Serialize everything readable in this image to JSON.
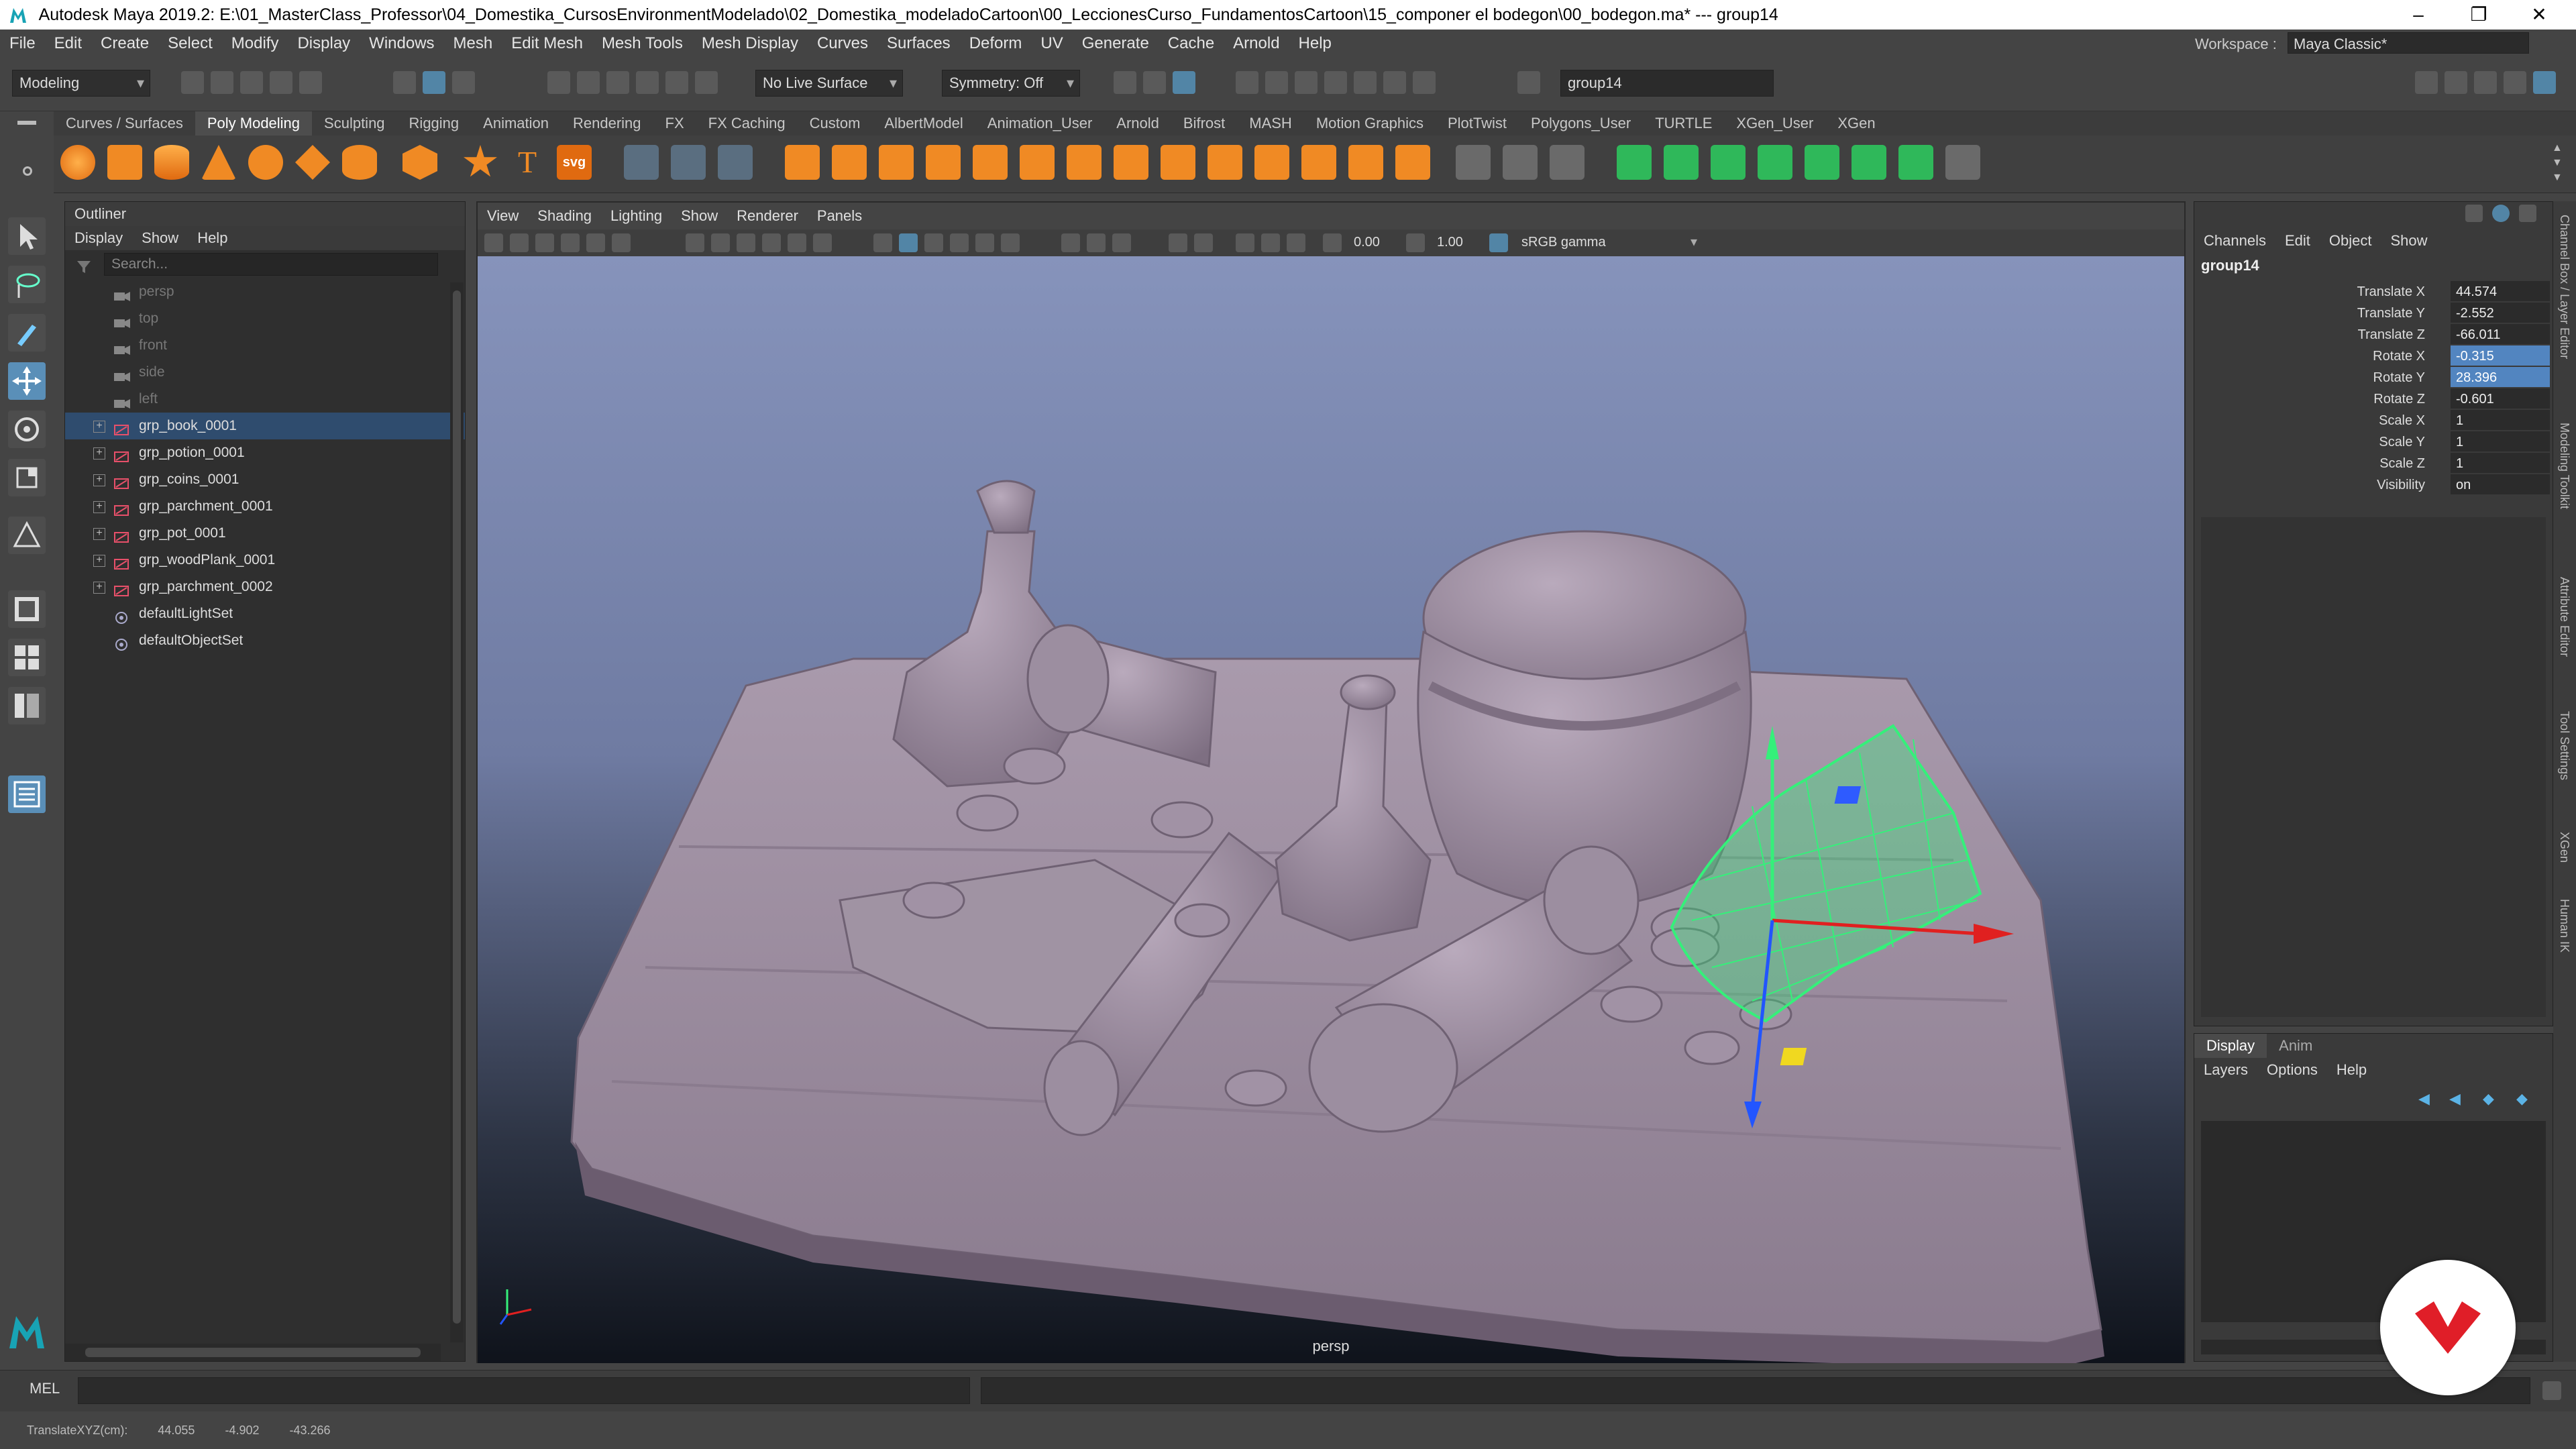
{
  "window": {
    "title": "Autodesk Maya 2019.2: E:\\01_MasterClass_Professor\\04_Domestika_CursosEnvironmentModelado\\02_Domestika_modeladoCartoon\\00_LeccionesCurso_FundamentosCartoon\\15_componer el bodegon\\00_bodegon.ma*   ---   group14",
    "controls": [
      "–",
      "❐",
      "✕"
    ]
  },
  "menubar": [
    "File",
    "Edit",
    "Create",
    "Select",
    "Modify",
    "Display",
    "Windows",
    "Mesh",
    "Edit Mesh",
    "Mesh Tools",
    "Mesh Display",
    "Curves",
    "Surfaces",
    "Deform",
    "UV",
    "Generate",
    "Cache",
    "Arnold",
    "Help"
  ],
  "workspace": {
    "label": "Workspace :",
    "value": "Maya Classic*"
  },
  "statusline": {
    "menuset": "Modeling",
    "live_surface": "No Live Surface",
    "symmetry": "Symmetry: Off",
    "selection_field": "group14"
  },
  "shelf_tabs": [
    "Curves / Surfaces",
    "Poly Modeling",
    "Sculpting",
    "Rigging",
    "Animation",
    "Rendering",
    "FX",
    "FX Caching",
    "Custom",
    "AlbertModel",
    "Animation_User",
    "Arnold",
    "Bifrost",
    "MASH",
    "Motion Graphics",
    "PlotTwist",
    "Polygons_User",
    "TURTLE",
    "XGen_User",
    "XGen"
  ],
  "shelf_active": "Poly Modeling",
  "shelf_labels": {
    "text_tool": "T",
    "svg_tool": "svg"
  },
  "colors": {
    "accent": "#5285c0",
    "shelf_orange": "#f08a24",
    "shelf_green": "#2fb85a",
    "manip_green": "#35f07a"
  },
  "outliner": {
    "title": "Outliner",
    "menu": [
      "Display",
      "Show",
      "Help"
    ],
    "search_placeholder": "Search...",
    "items": [
      {
        "label": "persp",
        "kind": "camera",
        "dim": true
      },
      {
        "label": "top",
        "kind": "camera",
        "dim": true
      },
      {
        "label": "front",
        "kind": "camera",
        "dim": true
      },
      {
        "label": "side",
        "kind": "camera",
        "dim": true
      },
      {
        "label": "left",
        "kind": "camera",
        "dim": true
      },
      {
        "label": "grp_book_0001",
        "kind": "group",
        "selected": true
      },
      {
        "label": "grp_potion_0001",
        "kind": "group"
      },
      {
        "label": "grp_coins_0001",
        "kind": "group"
      },
      {
        "label": "grp_parchment_0001",
        "kind": "group"
      },
      {
        "label": "grp_pot_0001",
        "kind": "group"
      },
      {
        "label": "grp_woodPlank_0001",
        "kind": "group"
      },
      {
        "label": "grp_parchment_0002",
        "kind": "group"
      },
      {
        "label": "defaultLightSet",
        "kind": "set"
      },
      {
        "label": "defaultObjectSet",
        "kind": "set"
      }
    ]
  },
  "viewport": {
    "menu": [
      "View",
      "Shading",
      "Lighting",
      "Show",
      "Renderer",
      "Panels"
    ],
    "exposure": "0.00",
    "gamma": "1.00",
    "color_space": "sRGB gamma",
    "camera": "persp"
  },
  "channelbox": {
    "menu": [
      "Channels",
      "Edit",
      "Object",
      "Show"
    ],
    "object": "group14",
    "channels": [
      {
        "name": "Translate X",
        "value": "44.574"
      },
      {
        "name": "Translate Y",
        "value": "-2.552"
      },
      {
        "name": "Translate Z",
        "value": "-66.011"
      },
      {
        "name": "Rotate X",
        "value": "-0.315",
        "highlight": true
      },
      {
        "name": "Rotate Y",
        "value": "28.396",
        "highlight": true
      },
      {
        "name": "Rotate Z",
        "value": "-0.601"
      },
      {
        "name": "Scale X",
        "value": "1"
      },
      {
        "name": "Scale Y",
        "value": "1"
      },
      {
        "name": "Scale Z",
        "value": "1"
      },
      {
        "name": "Visibility",
        "value": "on"
      }
    ]
  },
  "layer_editor": {
    "tabs": [
      "Display",
      "Anim"
    ],
    "menu": [
      "Layers",
      "Options",
      "Help"
    ]
  },
  "side_tabs": [
    "Channel Box / Layer Editor",
    "Modeling Toolkit",
    "Attribute Editor",
    "Tool Settings",
    "XGen",
    "Human IK"
  ],
  "cmdline": {
    "label": "MEL"
  },
  "helpline": {
    "label": "TranslateXYZ(cm):",
    "x": "44.055",
    "y": "-4.902",
    "z": "-43.266"
  }
}
